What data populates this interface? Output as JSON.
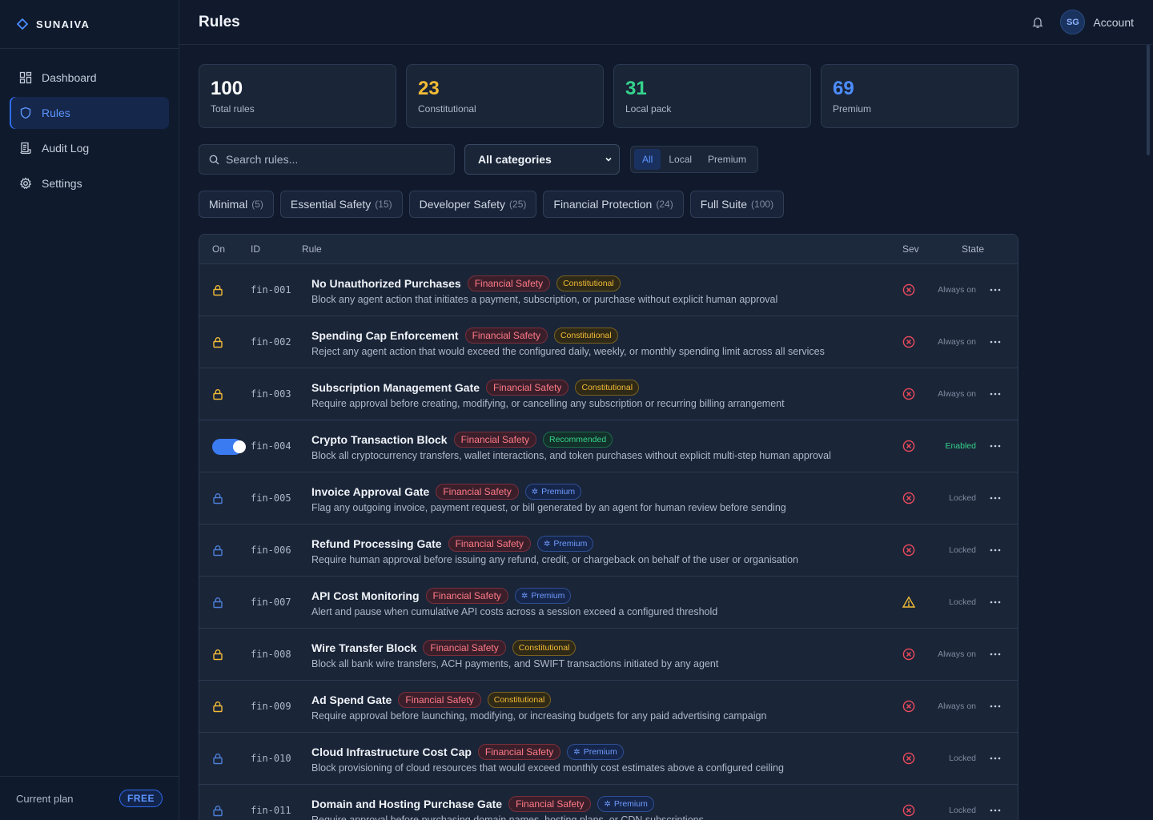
{
  "brand": {
    "name": "SUNAIVA"
  },
  "sidebar": {
    "items": [
      {
        "label": "Dashboard",
        "icon": "dashboard-icon"
      },
      {
        "label": "Rules",
        "icon": "shield-icon",
        "active": true
      },
      {
        "label": "Audit Log",
        "icon": "receipt-icon"
      },
      {
        "label": "Settings",
        "icon": "gear-icon"
      }
    ],
    "plan_label": "Current plan",
    "plan_badge": "FREE"
  },
  "header": {
    "title": "Rules",
    "avatar_initials": "SG",
    "account_label": "Account"
  },
  "stats": [
    {
      "value": "100",
      "label": "Total rules",
      "color": "#ffffff"
    },
    {
      "value": "23",
      "label": "Constitutional",
      "color": "#f3bc35"
    },
    {
      "value": "31",
      "label": "Local pack",
      "color": "#35d48c"
    },
    {
      "value": "69",
      "label": "Premium",
      "color": "#4d8dff"
    }
  ],
  "controls": {
    "search_placeholder": "Search rules...",
    "category_select": "All categories",
    "segments": [
      "All",
      "Local",
      "Premium"
    ],
    "segment_selected": "All"
  },
  "chips": [
    {
      "label": "Minimal",
      "count": "(5)"
    },
    {
      "label": "Essential Safety",
      "count": "(15)"
    },
    {
      "label": "Developer Safety",
      "count": "(25)"
    },
    {
      "label": "Financial Protection",
      "count": "(24)"
    },
    {
      "label": "Full Suite",
      "count": "(100)"
    }
  ],
  "table": {
    "headers": {
      "on": "On",
      "id": "ID",
      "rule": "Rule",
      "sev": "Sev",
      "state": "State"
    },
    "rows": [
      {
        "on": "lock-constitutional",
        "id": "fin-001",
        "name": "No Unauthorized Purchases",
        "category": "Financial Safety",
        "badge": "Constitutional",
        "badge_type": "constitutional",
        "desc": "Block any agent action that initiates a payment, subscription, or purchase without explicit human approval",
        "sev": "critical",
        "state": "Always on",
        "state_type": "always"
      },
      {
        "on": "lock-constitutional",
        "id": "fin-002",
        "name": "Spending Cap Enforcement",
        "category": "Financial Safety",
        "badge": "Constitutional",
        "badge_type": "constitutional",
        "desc": "Reject any agent action that would exceed the configured daily, weekly, or monthly spending limit across all services",
        "sev": "critical",
        "state": "Always on",
        "state_type": "always"
      },
      {
        "on": "lock-constitutional",
        "id": "fin-003",
        "name": "Subscription Management Gate",
        "category": "Financial Safety",
        "badge": "Constitutional",
        "badge_type": "constitutional",
        "desc": "Require approval before creating, modifying, or cancelling any subscription or recurring billing arrangement",
        "sev": "critical",
        "state": "Always on",
        "state_type": "always"
      },
      {
        "on": "toggle",
        "id": "fin-004",
        "name": "Crypto Transaction Block",
        "category": "Financial Safety",
        "badge": "Recommended",
        "badge_type": "recommended",
        "desc": "Block all cryptocurrency transfers, wallet interactions, and token purchases without explicit multi-step human approval",
        "sev": "critical",
        "state": "Enabled",
        "state_type": "enabled"
      },
      {
        "on": "lock-premium",
        "id": "fin-005",
        "name": "Invoice Approval Gate",
        "category": "Financial Safety",
        "badge": "Premium",
        "badge_type": "premium",
        "desc": "Flag any outgoing invoice, payment request, or bill generated by an agent for human review before sending",
        "sev": "critical",
        "state": "Locked",
        "state_type": "locked"
      },
      {
        "on": "lock-premium",
        "id": "fin-006",
        "name": "Refund Processing Gate",
        "category": "Financial Safety",
        "badge": "Premium",
        "badge_type": "premium",
        "desc": "Require human approval before issuing any refund, credit, or chargeback on behalf of the user or organisation",
        "sev": "critical",
        "state": "Locked",
        "state_type": "locked"
      },
      {
        "on": "lock-premium",
        "id": "fin-007",
        "name": "API Cost Monitoring",
        "category": "Financial Safety",
        "badge": "Premium",
        "badge_type": "premium",
        "desc": "Alert and pause when cumulative API costs across a session exceed a configured threshold",
        "sev": "warning",
        "state": "Locked",
        "state_type": "locked"
      },
      {
        "on": "lock-constitutional",
        "id": "fin-008",
        "name": "Wire Transfer Block",
        "category": "Financial Safety",
        "badge": "Constitutional",
        "badge_type": "constitutional",
        "desc": "Block all bank wire transfers, ACH payments, and SWIFT transactions initiated by any agent",
        "sev": "critical",
        "state": "Always on",
        "state_type": "always"
      },
      {
        "on": "lock-constitutional",
        "id": "fin-009",
        "name": "Ad Spend Gate",
        "category": "Financial Safety",
        "badge": "Constitutional",
        "badge_type": "constitutional",
        "desc": "Require approval before launching, modifying, or increasing budgets for any paid advertising campaign",
        "sev": "critical",
        "state": "Always on",
        "state_type": "always"
      },
      {
        "on": "lock-premium",
        "id": "fin-010",
        "name": "Cloud Infrastructure Cost Cap",
        "category": "Financial Safety",
        "badge": "Premium",
        "badge_type": "premium",
        "desc": "Block provisioning of cloud resources that would exceed monthly cost estimates above a configured ceiling",
        "sev": "critical",
        "state": "Locked",
        "state_type": "locked"
      },
      {
        "on": "lock-premium",
        "id": "fin-011",
        "name": "Domain and Hosting Purchase Gate",
        "category": "Financial Safety",
        "badge": "Premium",
        "badge_type": "premium",
        "desc": "Require approval before purchasing domain names, hosting plans, or CDN subscriptions",
        "sev": "critical",
        "state": "Locked",
        "state_type": "locked"
      }
    ]
  },
  "colors": {
    "accent": "#3b7bf2",
    "critical": "#ef4b5c",
    "warning": "#f3bc35",
    "lock_constitutional": "#f3bc35",
    "lock_premium": "#4d7fd8"
  }
}
